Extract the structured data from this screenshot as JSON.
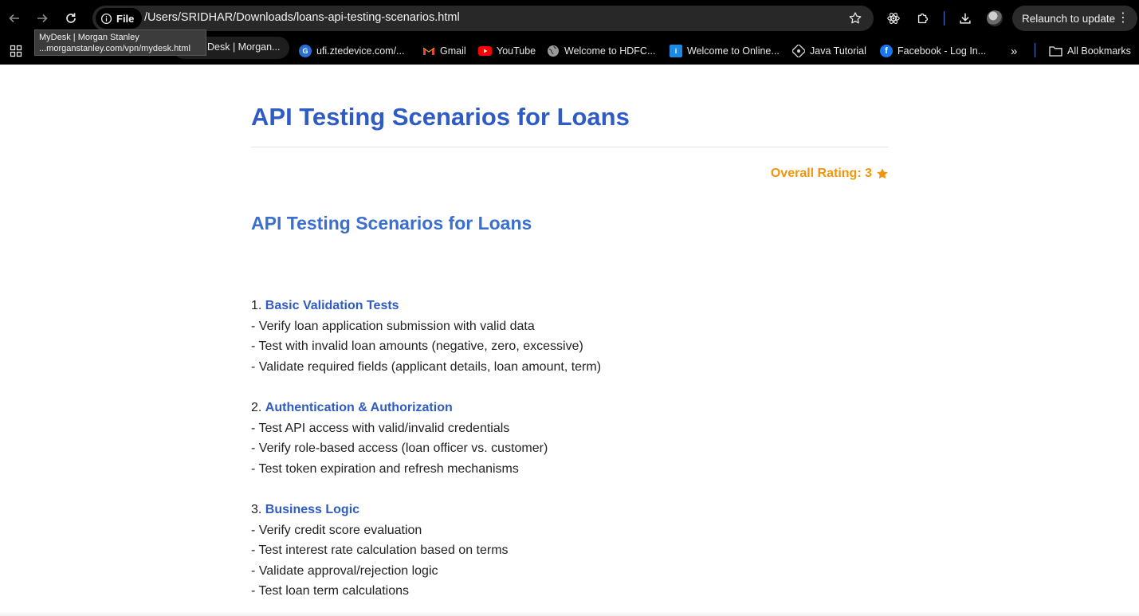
{
  "browser": {
    "file_label": "File",
    "url": "/Users/SRIDHAR/Downloads/loans-api-testing-scenarios.html",
    "relaunch_label": "Relaunch to update",
    "accent_divider": "#3a78c8"
  },
  "tooltip": {
    "title": "MyDesk | Morgan Stanley",
    "url": "...morganstanley.com/vpn/mydesk.html"
  },
  "bookmarks": {
    "items": [
      {
        "label": "Desk | Morgan...",
        "icon": "mydesk-icon"
      },
      {
        "label": "ufi.ztedevice.com/...",
        "icon": "zte-icon"
      },
      {
        "label": "Gmail",
        "icon": "gmail-icon"
      },
      {
        "label": "YouTube",
        "icon": "youtube-icon"
      },
      {
        "label": "Welcome to HDFC...",
        "icon": "globe-icon"
      },
      {
        "label": "Welcome to Online...",
        "icon": "online-icon"
      },
      {
        "label": "Java Tutorial",
        "icon": "java-icon"
      },
      {
        "label": "Facebook - Log In...",
        "icon": "facebook-icon"
      }
    ],
    "overflow": "»",
    "all_bookmarks": "All Bookmarks"
  },
  "page": {
    "title": "API Testing Scenarios for Loans",
    "rating_label": "Overall Rating: 3",
    "rating_value": 3,
    "rating_color": "#f0960e",
    "subtitle": "API Testing Scenarios for Loans",
    "title_color": "#2f5bc4",
    "sections": [
      {
        "number": "1.",
        "title": "Basic Validation Tests",
        "items": [
          "- Verify loan application submission with valid data",
          "- Test with invalid loan amounts (negative, zero, excessive)",
          "- Validate required fields (applicant details, loan amount, term)"
        ]
      },
      {
        "number": "2.",
        "title": "Authentication & Authorization",
        "items": [
          "- Test API access with valid/invalid credentials",
          "- Verify role-based access (loan officer vs. customer)",
          "- Test token expiration and refresh mechanisms"
        ]
      },
      {
        "number": "3.",
        "title": "Business Logic",
        "items": [
          "- Verify credit score evaluation",
          "- Test interest rate calculation based on terms",
          "- Validate approval/rejection logic",
          "- Test loan term calculations"
        ]
      }
    ]
  }
}
